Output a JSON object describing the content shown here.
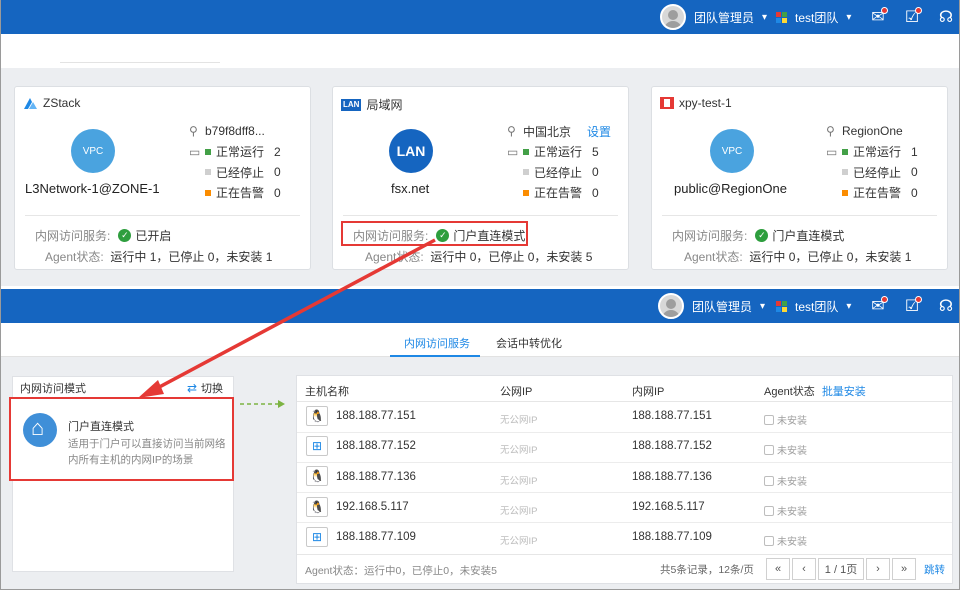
{
  "header": {
    "user_label": "团队管理员",
    "team_label": "test团队"
  },
  "cards": [
    {
      "brand": "ZStack",
      "network_name": "L3Network-1@ZONE-1",
      "circle_text": "VPC",
      "location": "b79f8dff8...",
      "setting_link": "",
      "running_label": "正常运行",
      "running_count": "2",
      "stopped_label": "已经停止",
      "stopped_count": "0",
      "alarm_label": "正在告警",
      "alarm_count": "0",
      "service_label": "内网访问服务:",
      "service_value": "已开启",
      "agent_label": "Agent状态:",
      "agent_value": "运行中 1，已停止 0，未安装 1"
    },
    {
      "brand": "局域网",
      "network_name": "fsx.net",
      "circle_text": "LAN",
      "location": "中国北京",
      "setting_link": "设置",
      "running_label": "正常运行",
      "running_count": "5",
      "stopped_label": "已经停止",
      "stopped_count": "0",
      "alarm_label": "正在告警",
      "alarm_count": "0",
      "service_label": "内网访问服务:",
      "service_value": "门户直连模式",
      "agent_label": "Agent状态:",
      "agent_value": "运行中 0，已停止 0，未安装 5"
    },
    {
      "brand": "xpy-test-1",
      "network_name": "public@RegionOne",
      "circle_text": "VPC",
      "location": "RegionOne",
      "setting_link": "",
      "running_label": "正常运行",
      "running_count": "1",
      "stopped_label": "已经停止",
      "stopped_count": "0",
      "alarm_label": "正在告警",
      "alarm_count": "0",
      "service_label": "内网访问服务:",
      "service_value": "门户直连模式",
      "agent_label": "Agent状态:",
      "agent_value": "运行中 0，已停止 0，未安装 1"
    }
  ],
  "tabs": [
    {
      "label": "内网访问服务",
      "active": true
    },
    {
      "label": "会话中转优化",
      "active": false
    }
  ],
  "left_panel": {
    "title": "内网访问模式",
    "switch_label": "切换",
    "mode_title": "门户直连模式",
    "mode_desc": "适用于门户可以直接访问当前网络内所有主机的内网IP的场景"
  },
  "table": {
    "columns": [
      "主机名称",
      "公网IP",
      "内网IP",
      "Agent状态"
    ],
    "batch_install": "批量安装",
    "rows": [
      {
        "os": "linux",
        "host": "188.188.77.151",
        "public_ip": "无公网IP",
        "private_ip": "188.188.77.151",
        "agent": "未安装"
      },
      {
        "os": "windows",
        "host": "188.188.77.152",
        "public_ip": "无公网IP",
        "private_ip": "188.188.77.152",
        "agent": "未安装"
      },
      {
        "os": "linux",
        "host": "188.188.77.136",
        "public_ip": "无公网IP",
        "private_ip": "188.188.77.136",
        "agent": "未安装"
      },
      {
        "os": "linux",
        "host": "192.168.5.117",
        "public_ip": "无公网IP",
        "private_ip": "192.168.5.117",
        "agent": "未安装"
      },
      {
        "os": "windows",
        "host": "188.188.77.109",
        "public_ip": "无公网IP",
        "private_ip": "188.188.77.109",
        "agent": "未安装"
      }
    ],
    "footer_status": "Agent状态：运行中0，已停止0，未安装5",
    "total": "共5条记录，12条/页",
    "page_label": "1 / 1页",
    "jump_label": "跳转"
  },
  "colors": {
    "header_blue": "#1565c0",
    "accent_blue": "#1e88e5",
    "highlight_red": "#e53935",
    "ok_green": "#2e9e3e"
  }
}
